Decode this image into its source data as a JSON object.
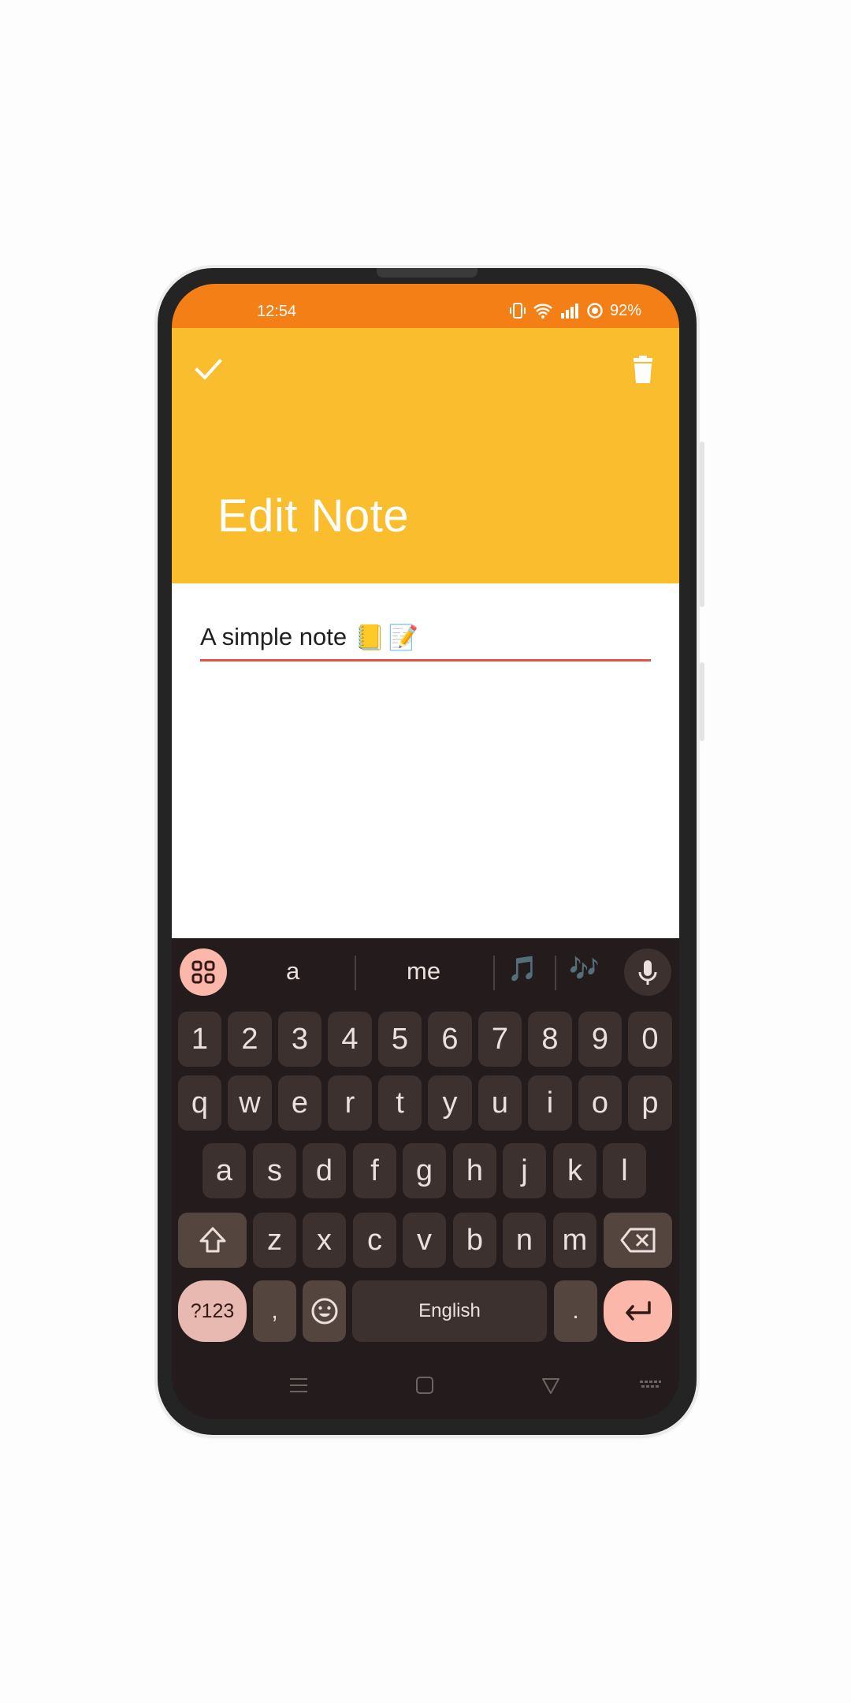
{
  "status_bar": {
    "time": "12:54",
    "battery": "92%"
  },
  "app_bar": {
    "title": "Edit Note"
  },
  "note": {
    "title_value": "A simple note",
    "emoji_1": "📒",
    "emoji_2": "📝"
  },
  "suggestions": {
    "word_1": "a",
    "word_2": "me",
    "emoji_1": "🎵",
    "emoji_2": "🎶"
  },
  "keyboard": {
    "number_row": [
      "1",
      "2",
      "3",
      "4",
      "5",
      "6",
      "7",
      "8",
      "9",
      "0"
    ],
    "row_1": [
      "q",
      "w",
      "e",
      "r",
      "t",
      "y",
      "u",
      "i",
      "o",
      "p"
    ],
    "row_2": [
      "a",
      "s",
      "d",
      "f",
      "g",
      "h",
      "j",
      "k",
      "l"
    ],
    "row_3": [
      "z",
      "x",
      "c",
      "v",
      "b",
      "n",
      "m"
    ],
    "symbols_key": "?123",
    "comma_key": ",",
    "space_key": "English",
    "period_key": "."
  },
  "colors": {
    "status_bar": "#f47f16",
    "app_bar": "#f9bd2e",
    "underline": "#e05548",
    "keyboard_bg": "#241c1c",
    "key_bg": "#3d3130",
    "accent_key": "#fab7aa"
  },
  "icons": {
    "save": "check-icon",
    "delete": "trash-icon",
    "emoji_panel": "grid-icon",
    "voice": "mic-icon",
    "shift": "shift-icon",
    "backspace": "backspace-icon",
    "emoji": "smiley-icon",
    "enter": "enter-icon"
  }
}
